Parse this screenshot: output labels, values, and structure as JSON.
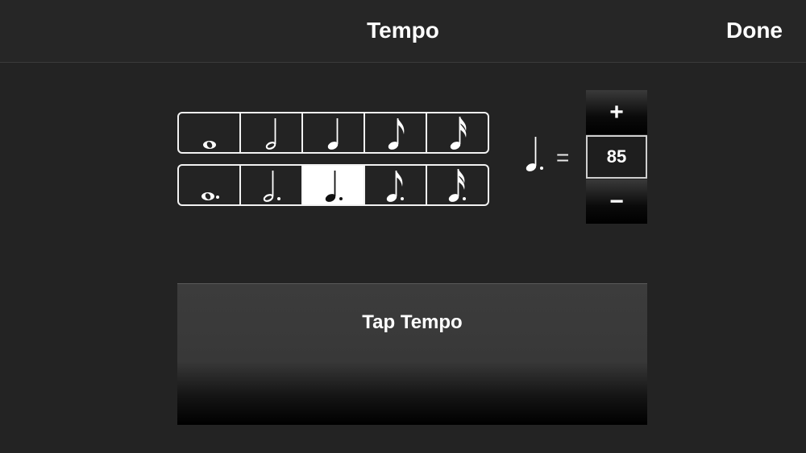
{
  "navbar": {
    "title": "Tempo",
    "done_label": "Done"
  },
  "note_rows": [
    {
      "row": "plain",
      "notes": [
        "whole-note-icon",
        "half-note-icon",
        "quarter-note-icon",
        "eighth-note-icon",
        "sixteenth-note-icon"
      ]
    },
    {
      "row": "dotted",
      "notes": [
        "dotted-whole-note-icon",
        "dotted-half-note-icon",
        "dotted-quarter-note-icon",
        "dotted-eighth-note-icon",
        "dotted-sixteenth-note-icon"
      ],
      "selected": "dotted-quarter-note-icon"
    }
  ],
  "tempo": {
    "beat_unit": "dotted-quarter-note-icon",
    "equals": "=",
    "value": "85",
    "plus_label": "+",
    "minus_label": "−"
  },
  "tap_tempo": {
    "label": "Tap Tempo"
  },
  "colors": {
    "background": "#232323",
    "border": "#f2f2f2",
    "selected_cell": "#ffffff"
  }
}
